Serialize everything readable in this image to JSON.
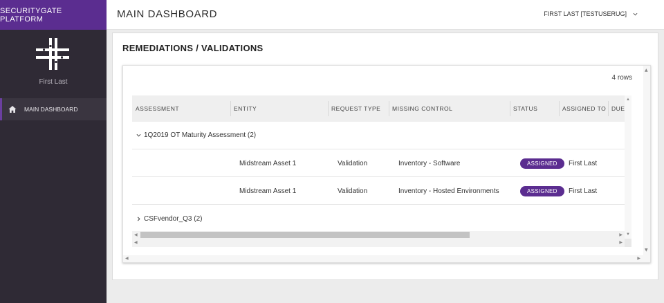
{
  "sidebar": {
    "brand": "SECURITYGATE PLATFORM",
    "user_name": "First Last",
    "nav_items": [
      {
        "label": "MAIN DASHBOARD",
        "icon": "home-icon",
        "active": true
      }
    ]
  },
  "header": {
    "title": "MAIN DASHBOARD",
    "user_menu": "FIRST LAST [TESTUSERUG]"
  },
  "section": {
    "title": "REMEDIATIONS / VALIDATIONS",
    "row_count": "4 rows"
  },
  "table": {
    "columns": [
      "ASSESSMENT",
      "ENTITY",
      "REQUEST TYPE",
      "MISSING CONTROL",
      "STATUS",
      "ASSIGNED TO",
      "DUE"
    ],
    "groups": [
      {
        "label": "1Q2019 OT Maturity Assessment (2)",
        "expanded": true,
        "rows": [
          {
            "entity": "Midstream Asset 1",
            "request_type": "Validation",
            "missing_control": "Inventory - Software",
            "status": "ASSIGNED",
            "assigned_to": "First Last"
          },
          {
            "entity": "Midstream Asset 1",
            "request_type": "Validation",
            "missing_control": "Inventory - Hosted Environments",
            "status": "ASSIGNED",
            "assigned_to": "First Last"
          }
        ]
      },
      {
        "label": "CSFvendor_Q3 (2)",
        "expanded": false,
        "rows": []
      }
    ]
  },
  "colors": {
    "brand": "#5b2d90",
    "sidebar_bg": "#2f2a35",
    "badge": "#5b2d90"
  }
}
